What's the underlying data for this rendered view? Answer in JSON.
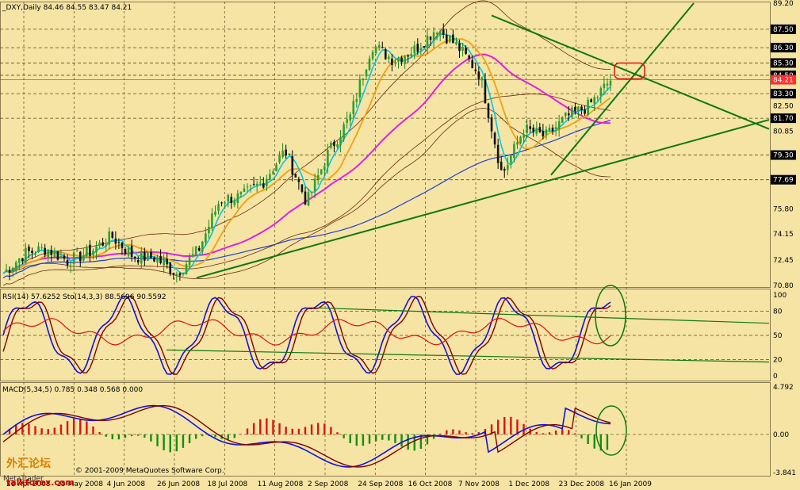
{
  "chart_data": [
    {
      "type": "candlestick",
      "header": "_DXY,Daily  84.46 84.55 83.47 84.21",
      "price_axis_ticks": [
        "89.20",
        "87.50",
        "86.30",
        "85.30",
        "84.50",
        "83.30",
        "82.50",
        "81.70",
        "80.85",
        "79.30",
        "77.69",
        "75.80",
        "74.15",
        "72.45",
        "70.80"
      ],
      "highlighted_ticks": [
        "87.50",
        "86.30",
        "85.30",
        "84.50",
        "83.30",
        "81.70",
        "79.30",
        "77.69"
      ],
      "last_price_label": "84.21",
      "ylim": [
        70.8,
        89.2
      ],
      "grid": true,
      "approx_close_path": [
        [
          "21 Apr 2008",
          71.6
        ],
        [
          "1 May 2008",
          72.9
        ],
        [
          "15 May 2008",
          73.2
        ],
        [
          "22 May 2008",
          72.4
        ],
        [
          "4 Jun 2008",
          73.0
        ],
        [
          "12 Jun 2008",
          74.0
        ],
        [
          "26 Jun 2008",
          72.7
        ],
        [
          "8 Jul 2008",
          72.6
        ],
        [
          "18 Jul 2008",
          71.6
        ],
        [
          "30 Jul 2008",
          73.1
        ],
        [
          "11 Aug 2008",
          76.4
        ],
        [
          "22 Aug 2008",
          76.6
        ],
        [
          "2 Sep 2008",
          77.6
        ],
        [
          "11 Sep 2008",
          79.6
        ],
        [
          "24 Sep 2008",
          76.2
        ],
        [
          "3 Oct 2008",
          79.5
        ],
        [
          "9 Oct 2008",
          81.8
        ],
        [
          "16 Oct 2008",
          86.5
        ],
        [
          "24 Oct 2008",
          85.5
        ],
        [
          "7 Nov 2008",
          86.2
        ],
        [
          "14 Nov 2008",
          87.6
        ],
        [
          "21 Nov 2008",
          86.3
        ],
        [
          "1 Dec 2008",
          84.5
        ],
        [
          "11 Dec 2008",
          78.0
        ],
        [
          "18 Dec 2008",
          81.0
        ],
        [
          "23 Dec 2008",
          80.5
        ],
        [
          "29 Dec 2008",
          81.8
        ],
        [
          "6 Jan 2009",
          82.5
        ],
        [
          "12 Jan 2009",
          84.2
        ]
      ]
    },
    {
      "type": "line",
      "header": "RSI(14) 57.6252  Sto(14,3,3) 88.5696 90.5592",
      "axis_ticks": [
        "100",
        "80",
        "50",
        "20",
        "0"
      ],
      "series": [
        {
          "name": "RSI(14)",
          "color": "#e01010",
          "last": 57.6252
        },
        {
          "name": "Sto(14,3,3)",
          "color": "#1010e0",
          "last": 88.5696
        },
        {
          "name": "Sto signal",
          "color": "#800000",
          "last": 90.5592
        }
      ]
    },
    {
      "type": "bar",
      "header": "MACD(5,34,5) 0.785 0.348 0.568 0.000",
      "axis_ticks": [
        "4.792",
        "0.00",
        "-3.841"
      ],
      "ylim": [
        -3.841,
        4.792
      ]
    }
  ],
  "date_axis": [
    "21 Apr 2008",
    "15 May 2008",
    "4 Jun 2008",
    "26 Jun 2008",
    "18 Jul 2008",
    "11 Aug 2008",
    "2 Sep 2008",
    "24 Sep 2008",
    "16 Oct 2008",
    "7 Nov 2008",
    "1 Dec 2008",
    "23 Dec 2008",
    "16 Jan 2009"
  ],
  "watermark": "© 2001-2009 MetaQuotes Software Corp.",
  "logo": {
    "chinese": "外汇论坛",
    "latin": "talkforex.com",
    "corner": "MetaTrader"
  },
  "colors": {
    "background": "#f5e4a4",
    "up": "#1e8a1e",
    "down": "#000000",
    "cyan_ma": "#00c8e6",
    "orange_ma": "#f0a010",
    "magenta_ma": "#e020e0",
    "blue_ma": "#2040d0",
    "trend": "#117711",
    "bands": "#6b2a10"
  }
}
